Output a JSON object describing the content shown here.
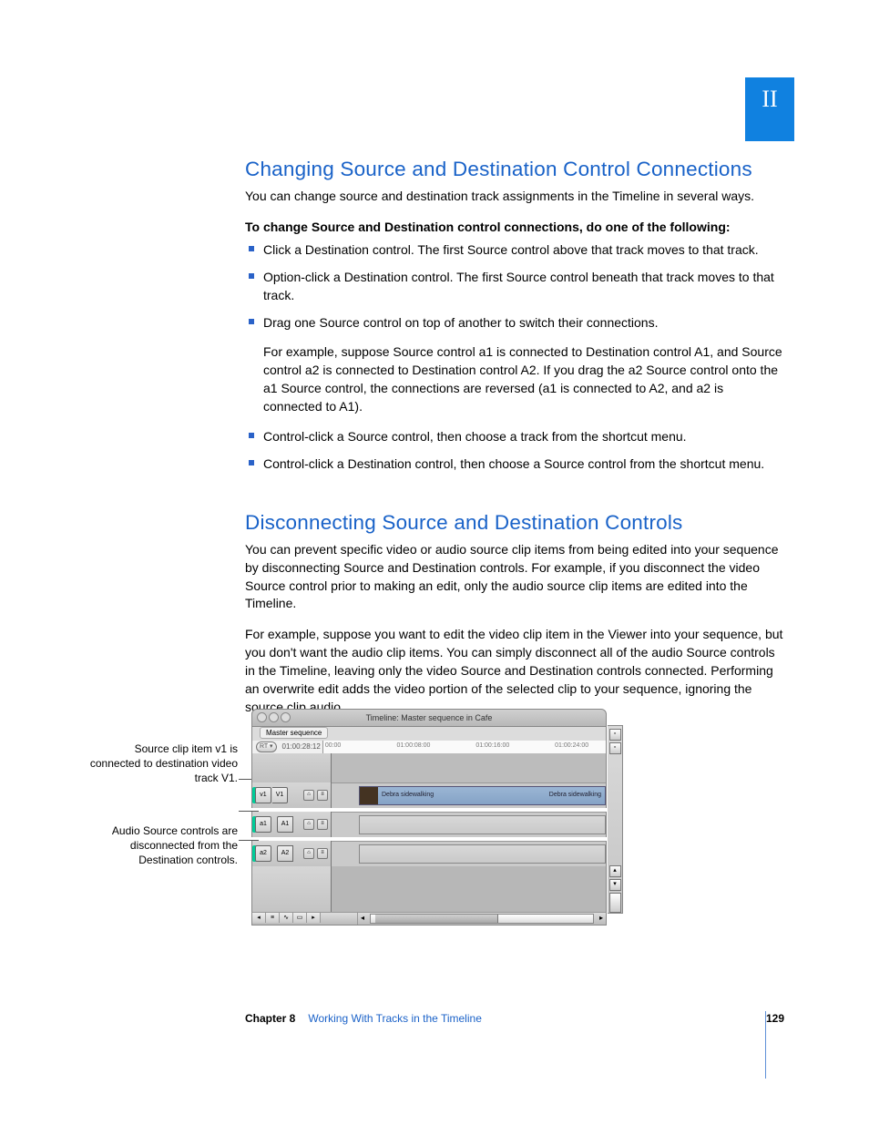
{
  "tab_label": "II",
  "section1": {
    "heading": "Changing Source and Destination Control Connections",
    "para1": "You can change source and destination track assignments in the Timeline in several ways.",
    "bold1": "To change Source and Destination control connections, do one of the following:",
    "bullet1": "Click a Destination control. The first Source control above that track moves to that track.",
    "bullet2": "Option-click a Destination control. The first Source control beneath that track moves to that track.",
    "bullet3": "Drag one Source control on top of another to switch their connections.",
    "bullet3_follow": "For example, suppose Source control a1 is connected to Destination control A1, and Source control a2 is connected to Destination control A2. If you drag the a2 Source control onto the a1 Source control, the connections are reversed (a1 is connected to A2, and a2 is connected to A1).",
    "bullet4": "Control-click a Source control, then choose a track from the shortcut menu.",
    "bullet5": "Control-click a Destination control, then choose a Source control from the shortcut menu."
  },
  "section2": {
    "heading": "Disconnecting Source and Destination Controls",
    "para1": "You can prevent specific video or audio source clip items from being edited into your sequence by disconnecting Source and Destination controls. For example, if you disconnect the video Source control prior to making an edit, only the audio source clip items are edited into the Timeline.",
    "para2": "For example, suppose you want to edit the video clip item in the Viewer into your sequence, but you don't want the audio clip items. You can simply disconnect all of the audio Source controls in the Timeline, leaving only the video Source and Destination controls connected. Performing an overwrite edit adds the video portion of the selected clip to your sequence, ignoring the source clip audio."
  },
  "callouts": {
    "c1": "Source clip item v1 is connected to destination video track V1.",
    "c2": "Audio Source controls are disconnected from the Destination controls."
  },
  "timeline": {
    "title": "Timeline: Master sequence in Cafe",
    "tab": "Master sequence",
    "rt": "RT ▾",
    "timecode": "01:00:28:12",
    "ruler_t1": "00:00",
    "ruler_t2": "01:00:08:00",
    "ruler_t3": "01:00:16:00",
    "ruler_t4": "01:00:24:00",
    "v1_src": "v1",
    "v1_dst": "V1",
    "a1_src": "a1",
    "a1_dst": "A1",
    "a2_src": "a2",
    "a2_dst": "A2",
    "clip1": "Debra sidewalking",
    "clip2": "Debra sidewalking"
  },
  "footer": {
    "chapter": "Chapter 8",
    "title": "Working With Tracks in the Timeline",
    "page": "129"
  }
}
